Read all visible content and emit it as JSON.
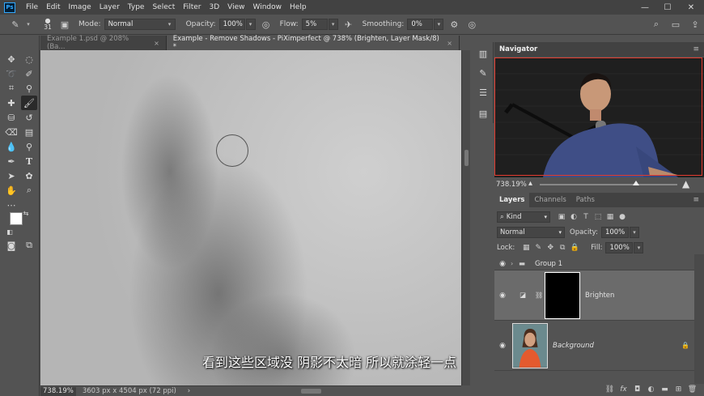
{
  "app": {
    "logo": "Ps"
  },
  "menu": [
    "File",
    "Edit",
    "Image",
    "Layer",
    "Type",
    "Select",
    "Filter",
    "3D",
    "View",
    "Window",
    "Help"
  ],
  "window_controls": {
    "minimize": "—",
    "maximize": "☐",
    "close": "✕"
  },
  "options": {
    "brush_size": "31",
    "mode_label": "Mode:",
    "mode_value": "Normal",
    "opacity_label": "Opacity:",
    "opacity_value": "100%",
    "flow_label": "Flow:",
    "flow_value": "5%",
    "smoothing_label": "Smoothing:",
    "smoothing_value": "0%"
  },
  "tabs": [
    {
      "label": "Example 1.psd @ 208% (Ba...",
      "close": "×"
    },
    {
      "label": "Example - Remove Shadows - PiXimperfect @ 738% (Brighten, Layer Mask/8) *",
      "close": "×"
    }
  ],
  "canvas": {
    "subtitle": "看到这些区域没 阴影不太暗 所以就涂轻一点"
  },
  "status": {
    "zoom": "738.19%",
    "info": "3603 px x 4504 px (72 ppi)",
    "arrow": "›"
  },
  "navigator": {
    "title": "Navigator",
    "zoom": "738.19%"
  },
  "layers_panel": {
    "tabs": [
      "Layers",
      "Channels",
      "Paths"
    ],
    "kind_label": "Kind",
    "blend_mode": "Normal",
    "opacity_label": "Opacity:",
    "opacity_value": "100%",
    "lock_label": "Lock:",
    "fill_label": "Fill:",
    "fill_value": "100%",
    "layers": [
      {
        "name": "Group 1",
        "type": "group"
      },
      {
        "name": "Brighten",
        "type": "adjustment"
      },
      {
        "name": "Background",
        "type": "image"
      }
    ]
  },
  "colors": {
    "accent": "#31a8ff",
    "nav_box": "#e23a2e"
  }
}
